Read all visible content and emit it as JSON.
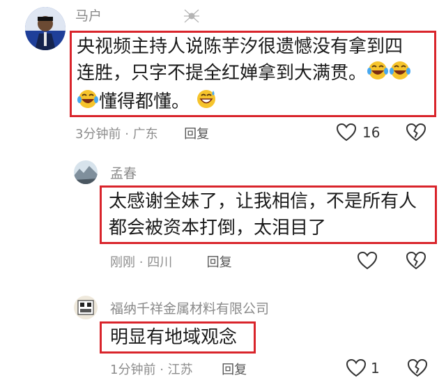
{
  "comments": [
    {
      "author": "马户",
      "text_line1": "央视频主持人说陈芋汐很遗憾没有拿到四",
      "text_line2": "连胜，只字不提全红婵拿到大满贯。",
      "text_line3": "懂得都懂。",
      "emojis": [
        "laughing-crying-emoji",
        "laughing-crying-emoji",
        "laughing-crying-emoji",
        "grinning-sweat-emoji"
      ],
      "time": "3分钟前",
      "location": "广东",
      "reply_label": "回复",
      "like_count": "16"
    },
    {
      "author": "孟春",
      "text_line1": "太感谢全妹了，让我相信，不是所有人",
      "text_line2": "都会被资本打倒，太泪目了",
      "time": "刚刚",
      "location": "四川",
      "reply_label": "回复"
    },
    {
      "author": "福纳千祥金属材料有限公司",
      "text_line1": "明显有地域观念",
      "time": "1分钟前",
      "location": "江苏",
      "reply_label": "回复",
      "like_count": "1"
    }
  ],
  "separator": "·",
  "colors": {
    "highlight_border": "#d9242b",
    "meta_text": "#8c8c8c"
  },
  "icons": [
    "heart-outline-icon",
    "broken-heart-icon"
  ]
}
